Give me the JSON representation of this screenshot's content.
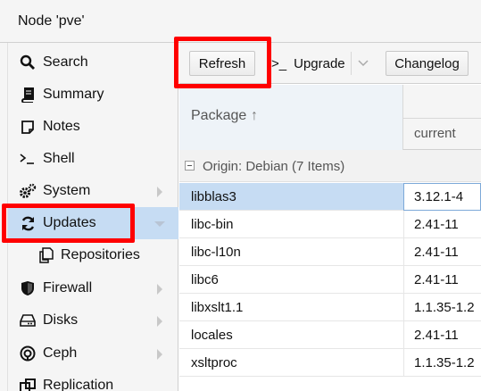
{
  "window": {
    "title": "Node 'pve'"
  },
  "nav": {
    "items": [
      {
        "label": "Search",
        "icon": "search-icon"
      },
      {
        "label": "Summary",
        "icon": "book-icon"
      },
      {
        "label": "Notes",
        "icon": "note-icon"
      },
      {
        "label": "Shell",
        "icon": "terminal-icon"
      },
      {
        "label": "System",
        "icon": "gears-icon"
      },
      {
        "label": "Updates",
        "icon": "refresh-icon",
        "selected": true
      },
      {
        "label": "Repositories",
        "icon": "copy-icon"
      },
      {
        "label": "Firewall",
        "icon": "shield-icon"
      },
      {
        "label": "Disks",
        "icon": "hdd-icon"
      },
      {
        "label": "Ceph",
        "icon": "ceph-icon"
      },
      {
        "label": "Replication",
        "icon": "replication-icon"
      }
    ]
  },
  "toolbar": {
    "refresh_label": "Refresh",
    "upgrade_label": "Upgrade",
    "upgrade_prefix": ">_",
    "changelog_label": "Changelog"
  },
  "grid": {
    "package_header": "Package",
    "current_header": "current",
    "group_label": "Origin: Debian (7 Items)",
    "rows": [
      {
        "package": "libblas3",
        "current": "3.12.1-4"
      },
      {
        "package": "libc-bin",
        "current": "2.41-11"
      },
      {
        "package": "libc-l10n",
        "current": "2.41-11"
      },
      {
        "package": "libc6",
        "current": "2.41-11"
      },
      {
        "package": "libxslt1.1",
        "current": "1.1.35-1.2"
      },
      {
        "package": "locales",
        "current": "2.41-11"
      },
      {
        "package": "xsltproc",
        "current": "1.1.35-1.2"
      }
    ]
  },
  "colors": {
    "selection": "#c6dcf3",
    "highlight_box": "#ff0000"
  }
}
